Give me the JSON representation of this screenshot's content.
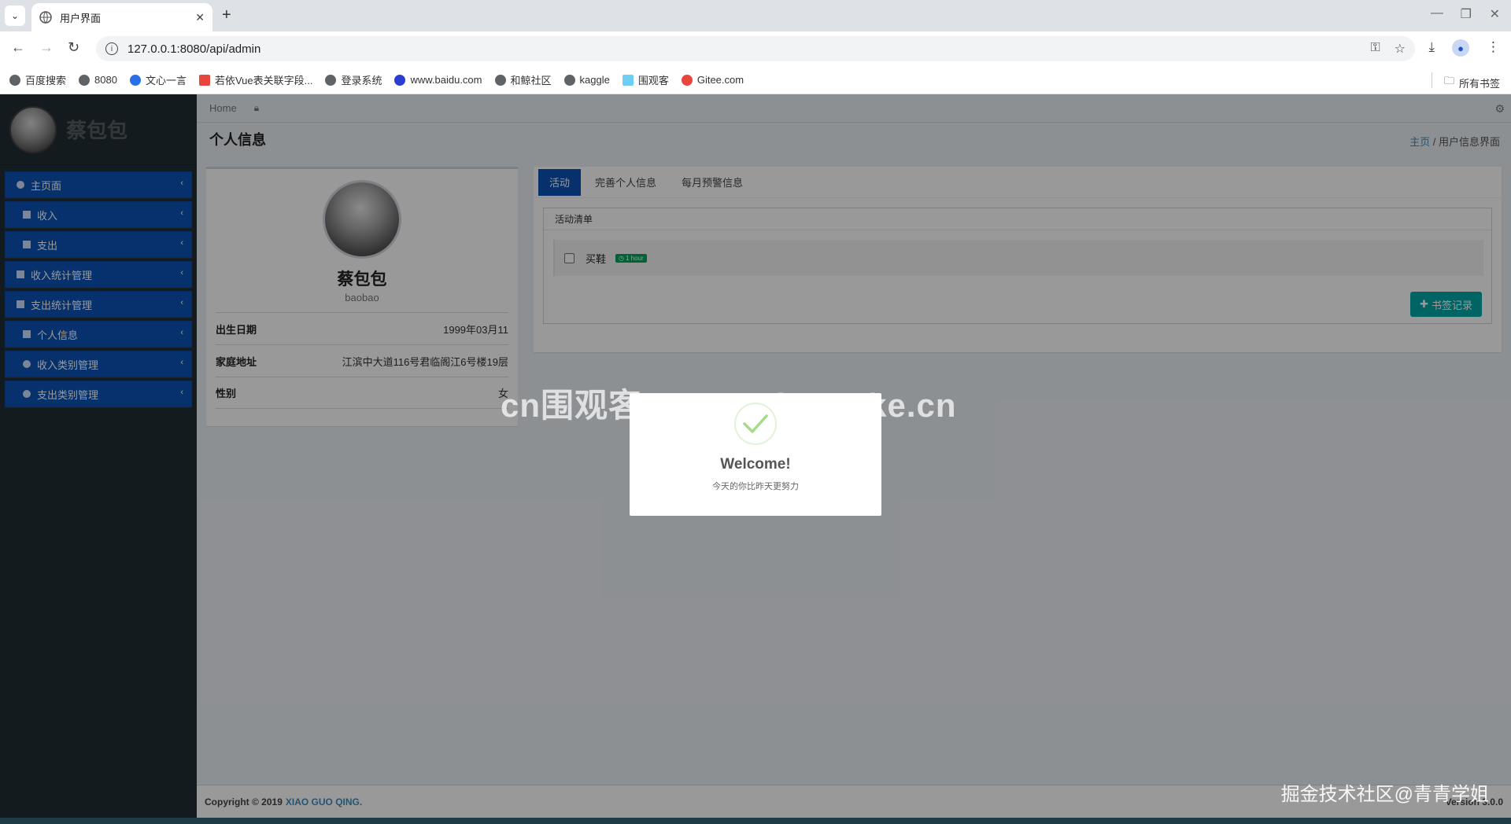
{
  "browser": {
    "tab_title": "用户界面",
    "url": "127.0.0.1:8080/api/admin",
    "bookmarks": [
      "百度搜索",
      "8080",
      "文心一言",
      "若依Vue表关联字段...",
      "登录系统",
      "www.baidu.com",
      "和鲸社区",
      "kaggle",
      "围观客",
      "Gitee.com"
    ],
    "all_bookmarks": "所有书签"
  },
  "sidebar": {
    "user_name": "蔡包包",
    "items": [
      {
        "label": "主页面"
      },
      {
        "label": "收入"
      },
      {
        "label": "支出"
      },
      {
        "label": "收入统计管理"
      },
      {
        "label": "支出统计管理"
      },
      {
        "label": "个人信息"
      },
      {
        "label": "收入类别管理"
      },
      {
        "label": "支出类别管理"
      }
    ]
  },
  "topnav": {
    "home": "Home"
  },
  "page": {
    "title": "个人信息",
    "breadcrumb_home": "主页",
    "breadcrumb_current": "用户信息界面"
  },
  "profile": {
    "name": "蔡包包",
    "username": "baobao",
    "fields": [
      {
        "key": "出生日期",
        "value": "1999年03月11"
      },
      {
        "key": "家庭地址",
        "value": "江滨中大道116号君临阁江6号楼19层"
      },
      {
        "key": "性别",
        "value": "女"
      }
    ]
  },
  "tabs": {
    "items": [
      {
        "label": "活动"
      },
      {
        "label": "完善个人信息"
      },
      {
        "label": "每月预警信息"
      }
    ],
    "activity_title": "活动清单",
    "todo_text": "买鞋",
    "todo_badge": "1 hour",
    "bookmark_button": "书签记录"
  },
  "footer": {
    "copyright": "Copyright © 2019",
    "company": "XIAO GUO QING.",
    "version": "Version 3.0.0"
  },
  "modal": {
    "title": "Welcome!",
    "text": "今天的你比昨天更努力"
  },
  "watermarks": {
    "top": "cn围观客www.weiguanke.cn",
    "bottom_right": "掘金技术社区@青青学姐"
  },
  "colors": {
    "sidebar_bg": "#222d32",
    "menu_item": "#0b53b5",
    "active_tab": "#0b53b5",
    "bookmark_button": "#00a7a7",
    "badge": "#00a65a",
    "link": "#3c8dbc"
  }
}
